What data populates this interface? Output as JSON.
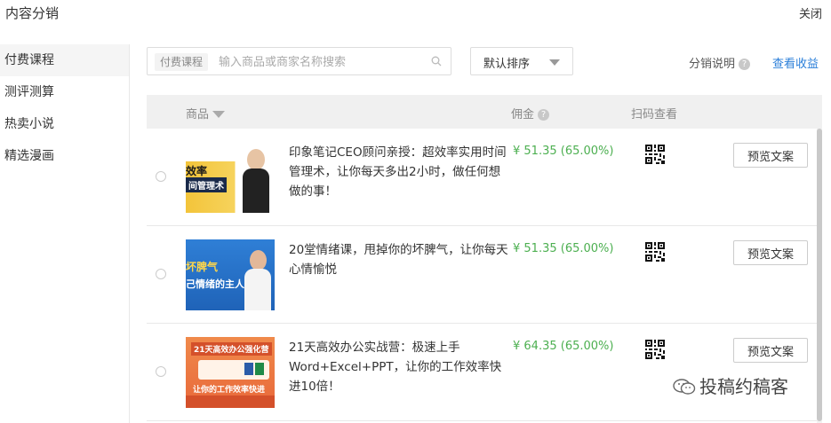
{
  "header": {
    "title": "内容分销",
    "close_label": "关闭"
  },
  "sidebar": {
    "items": [
      {
        "label": "付费课程",
        "active": true
      },
      {
        "label": "测评测算"
      },
      {
        "label": "热卖小说"
      },
      {
        "label": "精选漫画"
      }
    ]
  },
  "search": {
    "tag": "付费课程",
    "placeholder": "输入商品或商家名称搜索",
    "value": ""
  },
  "sort": {
    "label": "默认排序"
  },
  "links": {
    "help": "分销说明",
    "earnings": "查看收益"
  },
  "table": {
    "columns": {
      "product": "商品",
      "commission": "佣金",
      "qr": "扫码查看"
    },
    "rows": [
      {
        "name": "印象笔记CEO顾问亲授：超效率实用时间管理术，让你每天多出2小时，做任何想做的事！",
        "commission": "¥ 51.35 (65.00%)",
        "action": "预览文案",
        "thumb": {
          "title": "效率",
          "subtitle": "间管理术"
        }
      },
      {
        "name": "20堂情绪课，甩掉你的坏脾气，让你每天心情愉悦",
        "commission": "¥ 51.35 (65.00%)",
        "action": "预览文案",
        "thumb": {
          "title": "坏脾气",
          "subtitle": "己情绪的主人"
        }
      },
      {
        "name": "21天高效办公实战营：极速上手Word+Excel+PPT，让你的工作效率快进10倍！",
        "commission": "¥ 64.35 (65.00%)",
        "action": "预览文案",
        "thumb": {
          "title": "21天高效办公强化营",
          "subtitle": "让你的工作效率快进"
        }
      }
    ]
  },
  "watermark": {
    "text": "投稿约稿客"
  },
  "colors": {
    "accent": "#2b7fd9",
    "commission": "#4caf50"
  }
}
